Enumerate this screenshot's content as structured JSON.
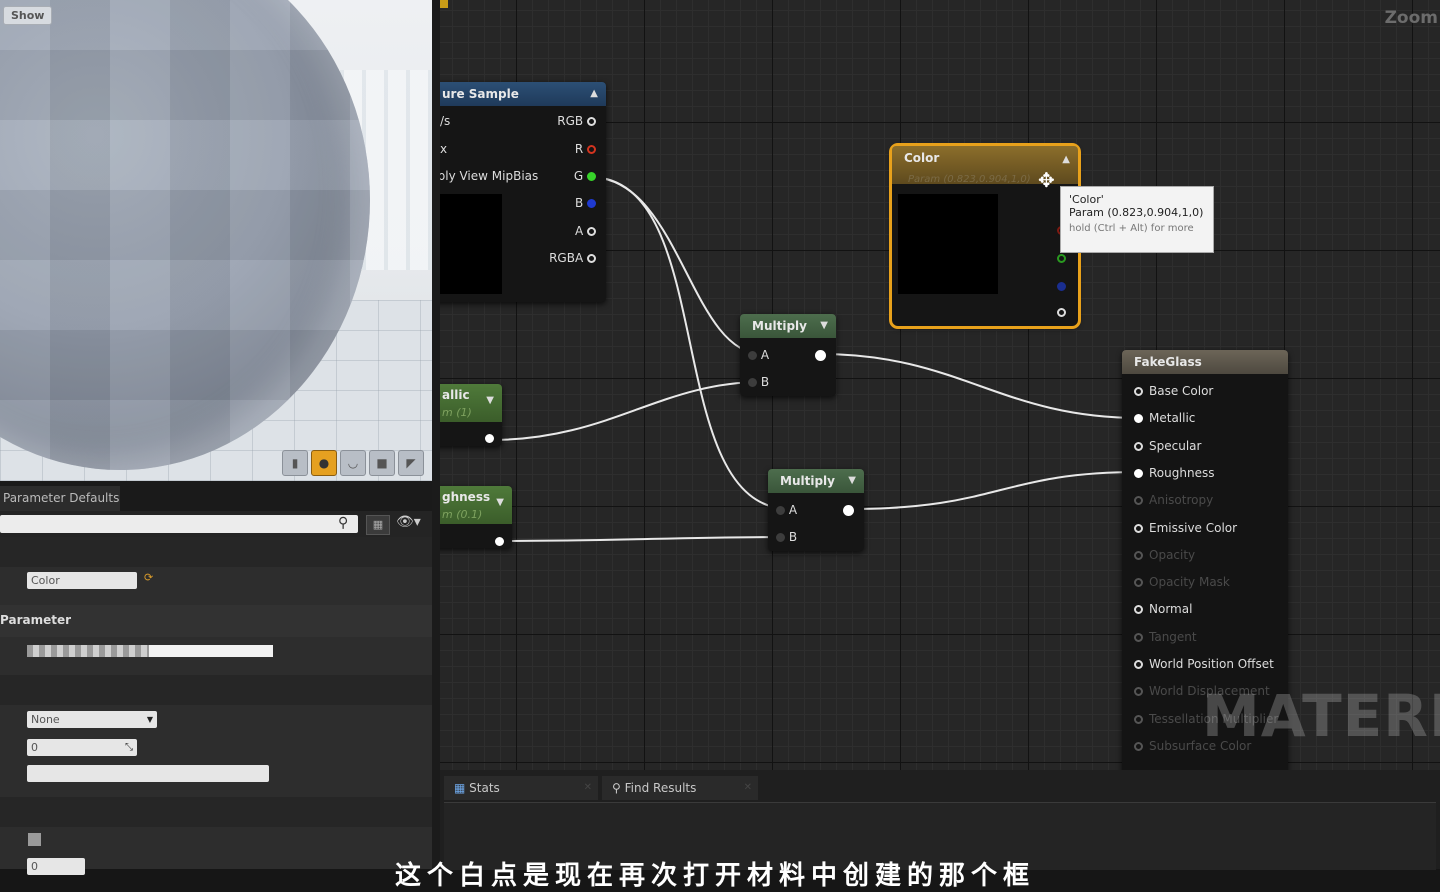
{
  "viewport": {
    "show_label": "Show"
  },
  "details": {
    "tab_label": "Parameter Defaults",
    "search_placeholder": "",
    "param_name": "Color",
    "category_label": "Parameter",
    "sampler_value": "None",
    "number_value": "0",
    "bottom_value": "0"
  },
  "graph": {
    "zoom_label": "Zoom",
    "watermark": "MATERIA",
    "texture_sample": {
      "title": "ure Sample",
      "inputs": [
        "/s",
        "x",
        "pply View MipBias"
      ],
      "outputs": [
        "RGB",
        "R",
        "G",
        "B",
        "A",
        "RGBA"
      ]
    },
    "metallic_param": {
      "title": "allic",
      "subtitle": "m (1)"
    },
    "roughness_param": {
      "title": "ghness",
      "subtitle": "m (0.1)"
    },
    "multiply_1": {
      "title": "Multiply",
      "input_a": "A",
      "input_b": "B"
    },
    "multiply_2": {
      "title": "Multiply",
      "input_a": "A",
      "input_b": "B"
    },
    "color_param": {
      "title": "Color",
      "subtitle": "Param (0.823,0.904,1,0)"
    },
    "tooltip": {
      "name": "'Color'",
      "value": "Param (0.823,0.904,1,0)",
      "hint": "hold (Ctrl + Alt) for more"
    },
    "material": {
      "title": "FakeGlass",
      "inputs": [
        {
          "label": "Base Color",
          "enabled": true
        },
        {
          "label": "Metallic",
          "enabled": true
        },
        {
          "label": "Specular",
          "enabled": true
        },
        {
          "label": "Roughness",
          "enabled": true
        },
        {
          "label": "Anisotropy",
          "enabled": false
        },
        {
          "label": "Emissive Color",
          "enabled": true
        },
        {
          "label": "Opacity",
          "enabled": false
        },
        {
          "label": "Opacity Mask",
          "enabled": false
        },
        {
          "label": "Normal",
          "enabled": true
        },
        {
          "label": "Tangent",
          "enabled": false
        },
        {
          "label": "World Position Offset",
          "enabled": true
        },
        {
          "label": "World Displacement",
          "enabled": false
        },
        {
          "label": "Tessellation Multiplier",
          "enabled": false
        },
        {
          "label": "Subsurface Color",
          "enabled": false
        }
      ]
    }
  },
  "bottom_panel": {
    "tabs": [
      {
        "label": "Stats",
        "icon": "stats-icon"
      },
      {
        "label": "Find Results",
        "icon": "find-results-icon"
      }
    ]
  },
  "subtitle": "这个白点是现在再次打开材料中创建的那个框",
  "colors": {
    "accent_orange": "#e8a11b",
    "texture_header": "#2c4f75",
    "param_header": "#4f7a3a",
    "multiply_header": "#4d6d4d",
    "material_header": "#6c6558"
  }
}
